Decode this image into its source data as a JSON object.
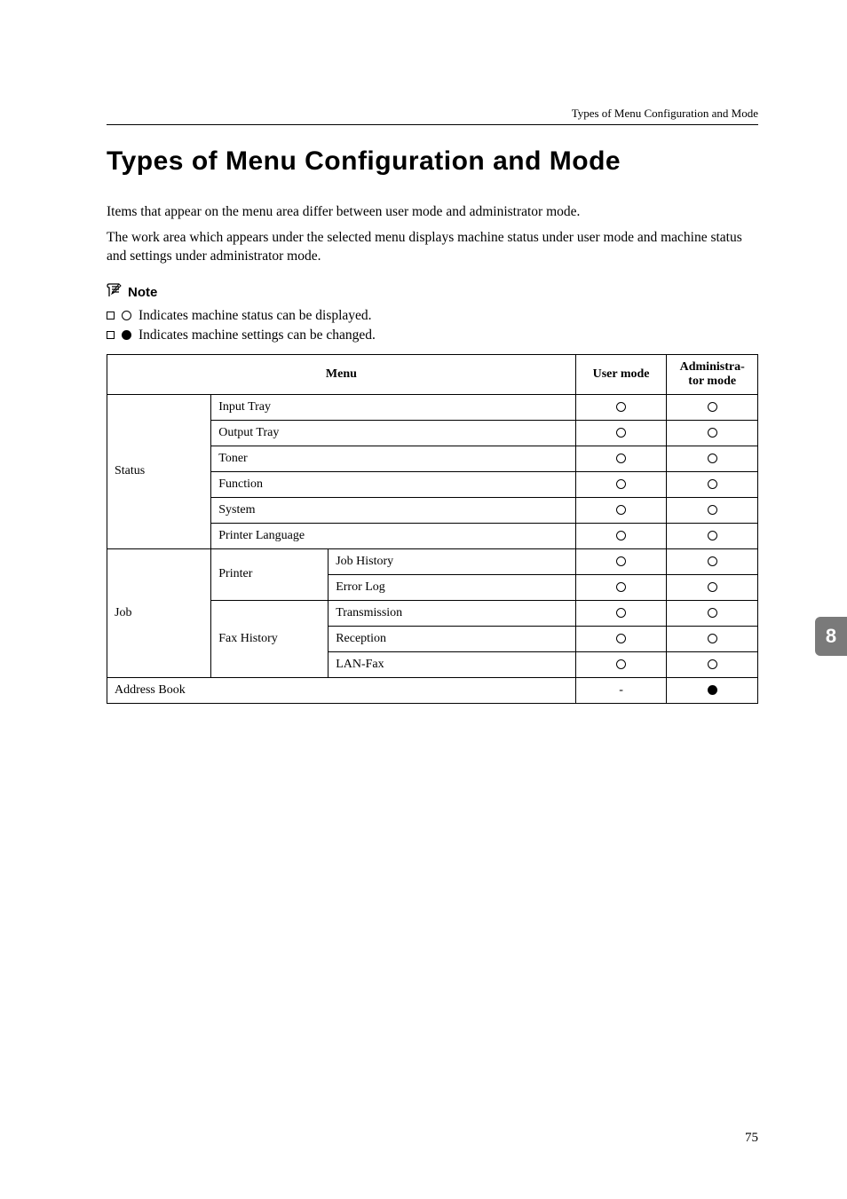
{
  "header_text": "Types of Menu Configuration and Mode",
  "title": "Types of Menu Configuration and Mode",
  "para1": "Items that appear on the menu area differ between user mode and administrator mode.",
  "para2": "The work area which appears under the selected menu displays machine status under user mode and machine status and settings under administrator mode.",
  "note_label": "Note",
  "bullets": {
    "b1": "Indicates machine status can be displayed.",
    "b2": "Indicates machine settings can be changed."
  },
  "table": {
    "headers": {
      "menu": "Menu",
      "user": "User mode",
      "admin": "Administra-\ntor mode"
    },
    "rows": {
      "status_label": "Status",
      "status_input": "Input Tray",
      "status_output": "Output Tray",
      "status_toner": "Toner",
      "status_function": "Function",
      "status_system": "System",
      "status_printer_lang": "Printer Language",
      "job_label": "Job",
      "job_printer": "Printer",
      "job_history": "Job History",
      "job_error": "Error Log",
      "job_faxhistory": "Fax History",
      "job_trans": "Transmission",
      "job_recep": "Reception",
      "job_lanfax": "LAN-Fax",
      "address_book": "Address Book"
    }
  },
  "side_tab": "8",
  "page_number": "75"
}
